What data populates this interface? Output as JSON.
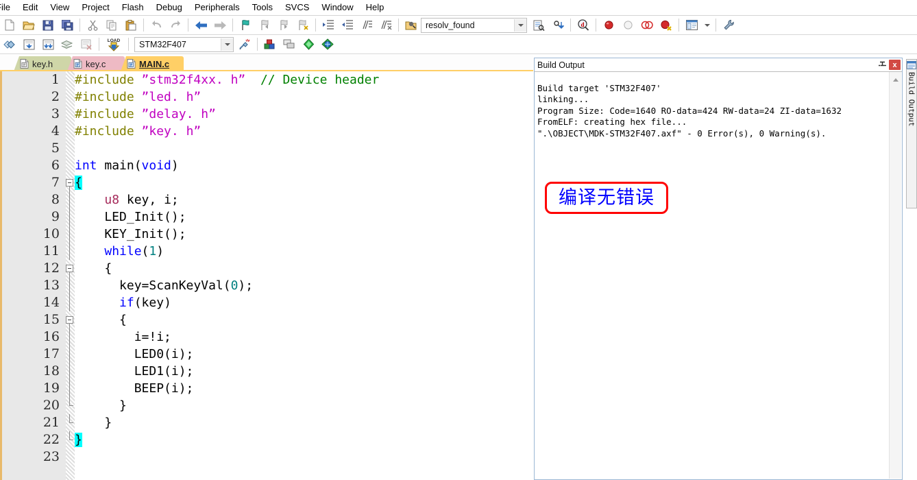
{
  "menu": {
    "items": [
      {
        "label": "File",
        "clipped": true
      },
      {
        "label": "Edit"
      },
      {
        "label": "View"
      },
      {
        "label": "Project"
      },
      {
        "label": "Flash"
      },
      {
        "label": "Debug"
      },
      {
        "label": "Peripherals"
      },
      {
        "label": "Tools"
      },
      {
        "label": "SVCS"
      },
      {
        "label": "Window"
      },
      {
        "label": "Help"
      }
    ]
  },
  "toolbar_main": {
    "buttons": [
      {
        "name": "new-file-icon",
        "title": "New"
      },
      {
        "name": "open-file-icon",
        "title": "Open"
      },
      {
        "name": "save-icon",
        "title": "Save"
      },
      {
        "name": "save-all-icon",
        "title": "Save All"
      },
      {
        "name": "cut-icon",
        "title": "Cut"
      },
      {
        "name": "copy-icon",
        "title": "Copy"
      },
      {
        "name": "paste-icon",
        "title": "Paste"
      },
      {
        "name": "undo-icon",
        "title": "Undo"
      },
      {
        "name": "redo-icon",
        "title": "Redo"
      },
      {
        "name": "navigate-back-icon",
        "title": "Back"
      },
      {
        "name": "navigate-forward-icon",
        "title": "Forward"
      },
      {
        "name": "bookmark-toggle-icon",
        "title": "Insert/Remove Bookmark"
      },
      {
        "name": "bookmark-prev-icon",
        "title": "Previous Bookmark"
      },
      {
        "name": "bookmark-next-icon",
        "title": "Next Bookmark"
      },
      {
        "name": "bookmark-clear-icon",
        "title": "Clear All Bookmarks"
      },
      {
        "name": "indent-icon",
        "title": "Indent"
      },
      {
        "name": "outdent-icon",
        "title": "Outdent"
      },
      {
        "name": "comment-icon",
        "title": "Comment"
      },
      {
        "name": "uncomment-icon",
        "title": "Uncomment"
      }
    ],
    "find": {
      "icon": "find-in-files-icon",
      "value": "resolv_found",
      "placeholder": "",
      "dropdown_icon": "chevron-down-icon"
    },
    "after_find": [
      {
        "name": "find-in-files-list-icon",
        "title": "Find in Files"
      },
      {
        "name": "insert-jump-icon",
        "title": "Go to Definition"
      },
      {
        "name": "browse-symbols-icon",
        "title": "Browse Symbols"
      },
      {
        "name": "breakpoint-icon",
        "title": "Insert/Remove Breakpoint"
      },
      {
        "name": "breakpoint-disable-icon",
        "title": "Enable/Disable Breakpoint"
      },
      {
        "name": "breakpoints-disable-all-icon",
        "title": "Disable All Breakpoints"
      },
      {
        "name": "breakpoints-kill-all-icon",
        "title": "Kill All Breakpoints"
      },
      {
        "name": "window-layout-icon",
        "title": "Manage Windows"
      },
      {
        "name": "window-layout-dropdown-icon",
        "title": "More"
      },
      {
        "name": "configure-tools-icon",
        "title": "Configure"
      }
    ]
  },
  "toolbar_build": {
    "buttons": [
      {
        "name": "translate-icon",
        "title": "Translate"
      },
      {
        "name": "build-icon",
        "title": "Build"
      },
      {
        "name": "rebuild-icon",
        "title": "Rebuild"
      },
      {
        "name": "batch-build-icon",
        "title": "Batch Build"
      },
      {
        "name": "stop-build-icon",
        "title": "Stop Build"
      },
      {
        "name": "download-icon",
        "title": "Download"
      }
    ],
    "target": {
      "value": "STM32F407",
      "dropdown_icon": "chevron-down-icon"
    },
    "after_target": [
      {
        "name": "target-options-icon",
        "title": "Options for Target"
      },
      {
        "name": "manage-project-items-icon",
        "title": "Manage Project Items"
      },
      {
        "name": "multi-project-icon",
        "title": "Multi-Project"
      },
      {
        "name": "pack-installer-icon",
        "title": "Pack Installer"
      },
      {
        "name": "run-time-env-icon",
        "title": "Manage Run-Time Environment"
      }
    ]
  },
  "tabs": [
    {
      "label": "key.h",
      "active": false,
      "icon": "header-file-icon"
    },
    {
      "label": "key.c",
      "active": false,
      "icon": "c-file-icon"
    },
    {
      "label": "MAIN.c",
      "active": true,
      "icon": "c-file-icon"
    }
  ],
  "editor": {
    "first_line": 1,
    "last_line": 23,
    "lines": [
      {
        "n": 1,
        "fold": "none",
        "tokens": [
          {
            "t": "#include ",
            "c": "k-pre"
          },
          {
            "t": "”stm32f4xx. h”",
            "c": "k-str"
          },
          {
            "t": "  ",
            "c": "k-pln"
          },
          {
            "t": "// Device header",
            "c": "k-cmt"
          }
        ]
      },
      {
        "n": 2,
        "fold": "none",
        "tokens": [
          {
            "t": "#include ",
            "c": "k-pre"
          },
          {
            "t": "”led. h”",
            "c": "k-str"
          }
        ]
      },
      {
        "n": 3,
        "fold": "none",
        "tokens": [
          {
            "t": "#include ",
            "c": "k-pre"
          },
          {
            "t": "”delay. h”",
            "c": "k-str"
          }
        ]
      },
      {
        "n": 4,
        "fold": "none",
        "tokens": [
          {
            "t": "#include ",
            "c": "k-pre"
          },
          {
            "t": "”key. h”",
            "c": "k-str"
          }
        ]
      },
      {
        "n": 5,
        "fold": "none",
        "tokens": []
      },
      {
        "n": 6,
        "fold": "none",
        "tokens": [
          {
            "t": "int",
            "c": "k-kw"
          },
          {
            "t": " main(",
            "c": "k-pln"
          },
          {
            "t": "void",
            "c": "k-kw"
          },
          {
            "t": ")",
            "c": "k-pln"
          }
        ]
      },
      {
        "n": 7,
        "fold": "start",
        "tokens": [
          {
            "t": "{",
            "c": "brace-hl"
          }
        ]
      },
      {
        "n": 8,
        "fold": "bar",
        "tokens": [
          {
            "t": "    ",
            "c": "k-pln"
          },
          {
            "t": "u8",
            "c": "k-typ"
          },
          {
            "t": " key, i;",
            "c": "k-pln"
          }
        ]
      },
      {
        "n": 9,
        "fold": "bar",
        "tokens": [
          {
            "t": "    LED_Init();",
            "c": "k-pln"
          }
        ]
      },
      {
        "n": 10,
        "fold": "bar",
        "tokens": [
          {
            "t": "    KEY_Init();",
            "c": "k-pln"
          }
        ]
      },
      {
        "n": 11,
        "fold": "bar",
        "tokens": [
          {
            "t": "    ",
            "c": "k-pln"
          },
          {
            "t": "while",
            "c": "k-kw"
          },
          {
            "t": "(",
            "c": "k-pln"
          },
          {
            "t": "1",
            "c": "k-num"
          },
          {
            "t": ")",
            "c": "k-pln"
          }
        ]
      },
      {
        "n": 12,
        "fold": "start",
        "tokens": [
          {
            "t": "    {",
            "c": "k-pln"
          }
        ]
      },
      {
        "n": 13,
        "fold": "bar",
        "tokens": [
          {
            "t": "      key=ScanKeyVal(",
            "c": "k-pln"
          },
          {
            "t": "0",
            "c": "k-num"
          },
          {
            "t": ");",
            "c": "k-pln"
          }
        ]
      },
      {
        "n": 14,
        "fold": "bar",
        "tokens": [
          {
            "t": "      ",
            "c": "k-pln"
          },
          {
            "t": "if",
            "c": "k-kw"
          },
          {
            "t": "(key)",
            "c": "k-pln"
          }
        ]
      },
      {
        "n": 15,
        "fold": "start",
        "tokens": [
          {
            "t": "      {",
            "c": "k-pln"
          }
        ]
      },
      {
        "n": 16,
        "fold": "bar",
        "tokens": [
          {
            "t": "        i=!i;",
            "c": "k-pln"
          }
        ]
      },
      {
        "n": 17,
        "fold": "bar",
        "tokens": [
          {
            "t": "        LED0(i);",
            "c": "k-pln"
          }
        ]
      },
      {
        "n": 18,
        "fold": "bar",
        "tokens": [
          {
            "t": "        LED1(i);",
            "c": "k-pln"
          }
        ]
      },
      {
        "n": 19,
        "fold": "bar",
        "tokens": [
          {
            "t": "        BEEP(i);",
            "c": "k-pln"
          }
        ]
      },
      {
        "n": 20,
        "fold": "end",
        "tokens": [
          {
            "t": "      }",
            "c": "k-pln"
          }
        ]
      },
      {
        "n": 21,
        "fold": "end",
        "tokens": [
          {
            "t": "    }",
            "c": "k-pln"
          }
        ]
      },
      {
        "n": 22,
        "fold": "end",
        "tokens": [
          {
            "t": "}",
            "c": "brace-hl"
          }
        ]
      },
      {
        "n": 23,
        "fold": "none",
        "tokens": []
      }
    ]
  },
  "build_output": {
    "title": "Build Output",
    "pin_icon": "pin-icon",
    "close_label": "x",
    "text": "Build target 'STM32F407'\nlinking...\nProgram Size: Code=1640 RO-data=424 RW-data=24 ZI-data=1632\nFromELF: creating hex file...\n\".\\OBJECT\\MDK-STM32F407.axf\" - 0 Error(s), 0 Warning(s)."
  },
  "annotation": {
    "text": "编译无错误",
    "border_color": "#ff0000",
    "text_color": "#0000ff"
  },
  "right_dock": {
    "label": "Build Output",
    "icon": "build-output-icon"
  },
  "colors": {
    "preprocessor": "#808000",
    "string": "#c000c0",
    "comment": "#008000",
    "keyword": "#0000ff",
    "type": "#a52a5a",
    "number": "#008080",
    "brace_highlight": "#00ffff",
    "tab_active": "#ffcf66",
    "tab_keyh": "#cfd6a8",
    "tab_keyc": "#eebac4"
  }
}
